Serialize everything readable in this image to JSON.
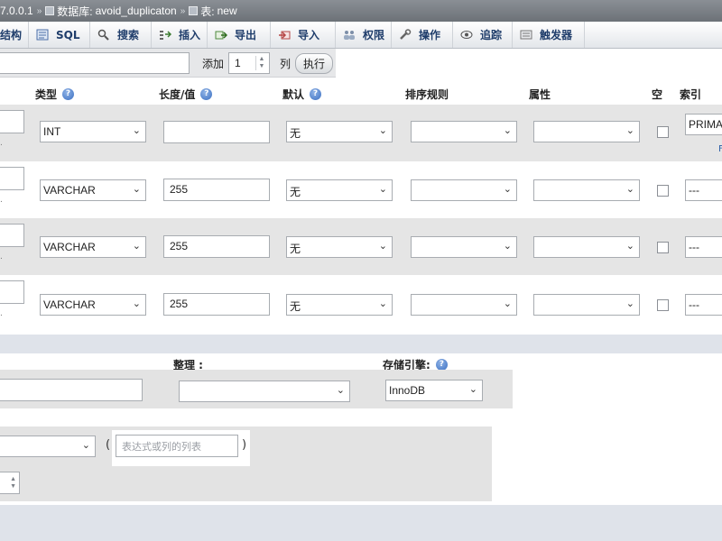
{
  "breadcrumb": {
    "server": "7.0.0.1",
    "database_label": "数据库:",
    "database": "avoid_duplicaton",
    "table_label": "表:",
    "table": "new",
    "separator": "»"
  },
  "tabs": [
    {
      "label": "结构",
      "icon": "structure-icon"
    },
    {
      "label": "SQL",
      "icon": "sql-icon"
    },
    {
      "label": "搜索",
      "icon": "search-icon"
    },
    {
      "label": "插入",
      "icon": "insert-icon"
    },
    {
      "label": "导出",
      "icon": "export-icon"
    },
    {
      "label": "导入",
      "icon": "import-icon"
    },
    {
      "label": "权限",
      "icon": "privileges-icon"
    },
    {
      "label": "操作",
      "icon": "operations-icon"
    },
    {
      "label": "追踪",
      "icon": "tracking-icon"
    },
    {
      "label": "触发器",
      "icon": "triggers-icon"
    }
  ],
  "add_columns": {
    "add_label": "添加",
    "count": "1",
    "columns_label": "列",
    "go_label": "执行"
  },
  "headers": {
    "type": "类型",
    "length": "长度/值",
    "default": "默认",
    "collation": "排序规则",
    "attributes": "属性",
    "null": "空",
    "index": "索引"
  },
  "rows": [
    {
      "type": "INT",
      "length": "",
      "default": "无",
      "collation": "",
      "attributes": "",
      "index": "PRIMA",
      "side": "F"
    },
    {
      "type": "VARCHAR",
      "length": "255",
      "default": "无",
      "collation": "",
      "attributes": "",
      "index": "---",
      "side": ""
    },
    {
      "type": "VARCHAR",
      "length": "255",
      "default": "无",
      "collation": "",
      "attributes": "",
      "index": "---",
      "side": ""
    },
    {
      "type": "VARCHAR",
      "length": "255",
      "default": "无",
      "collation": "",
      "attributes": "",
      "index": "---",
      "side": ""
    }
  ],
  "table_options": {
    "collation_label": "整理 :",
    "engine_label": "存储引擎:",
    "engine": "InnoDB"
  },
  "partition": {
    "open_paren": "(",
    "close_paren": ")",
    "expression_placeholder": "表达式或列的列表"
  },
  "colors": {
    "tab_text": "#1f3d6b",
    "band": "#dfe3ea",
    "row_grey": "#e5e5e5"
  }
}
